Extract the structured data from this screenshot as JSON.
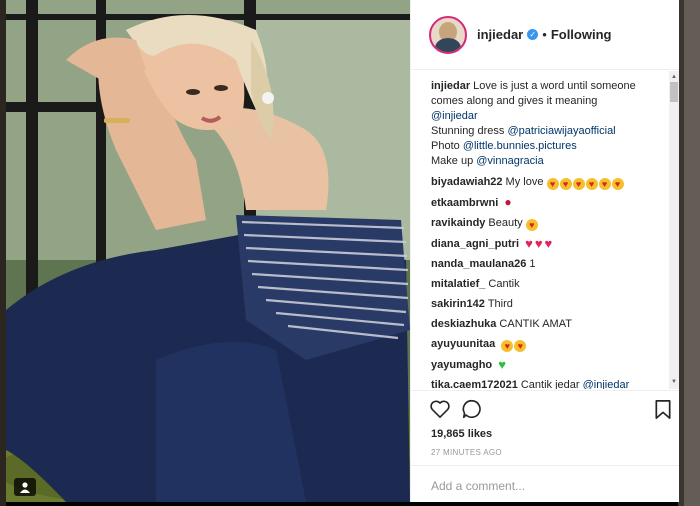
{
  "header": {
    "username": "injiedar",
    "following_label": "Following",
    "separator": "•"
  },
  "caption": {
    "username": "injiedar",
    "text": "Love is just a word until someone comes along and gives it meaning",
    "mention_self": "@injiedar",
    "dress_prefix": "Stunning dress",
    "dress_mention": "@patriciawijayaofficial",
    "photo_prefix": "Photo",
    "photo_mention": "@little.bunnies.pictures",
    "makeup_prefix": "Make up",
    "makeup_mention": "@vinnagracia"
  },
  "comments": [
    {
      "username": "biyadawiah22",
      "text": "My love"
    },
    {
      "username": "etkaambrwni",
      "text": ""
    },
    {
      "username": "ravikaindy",
      "text": "Beauty"
    },
    {
      "username": "diana_agni_putri",
      "text": ""
    },
    {
      "username": "nanda_maulana26",
      "text": "1"
    },
    {
      "username": "mitalatief_",
      "text": "Cantik"
    },
    {
      "username": "sakirin142",
      "text": "Third"
    },
    {
      "username": "deskiazhuka",
      "text": "CANTIK AMAT"
    },
    {
      "username": "ayuyuunitaa",
      "text": ""
    },
    {
      "username": "yayumagho",
      "text": ""
    },
    {
      "username": "tika.caem172021",
      "text": "Cantik jedar",
      "mention": "@injiedar"
    }
  ],
  "likes": "19,865 likes",
  "timestamp": "27 MINUTES AGO",
  "add_comment_placeholder": "Add a comment...",
  "colors": {
    "mention": "#003569",
    "verified": "#3897f0",
    "dress": "#1c2a52",
    "background_overlay": "#000000"
  },
  "icons": [
    "heart-icon",
    "comment-icon",
    "bookmark-icon",
    "verified-badge-icon",
    "user-tag-icon"
  ]
}
